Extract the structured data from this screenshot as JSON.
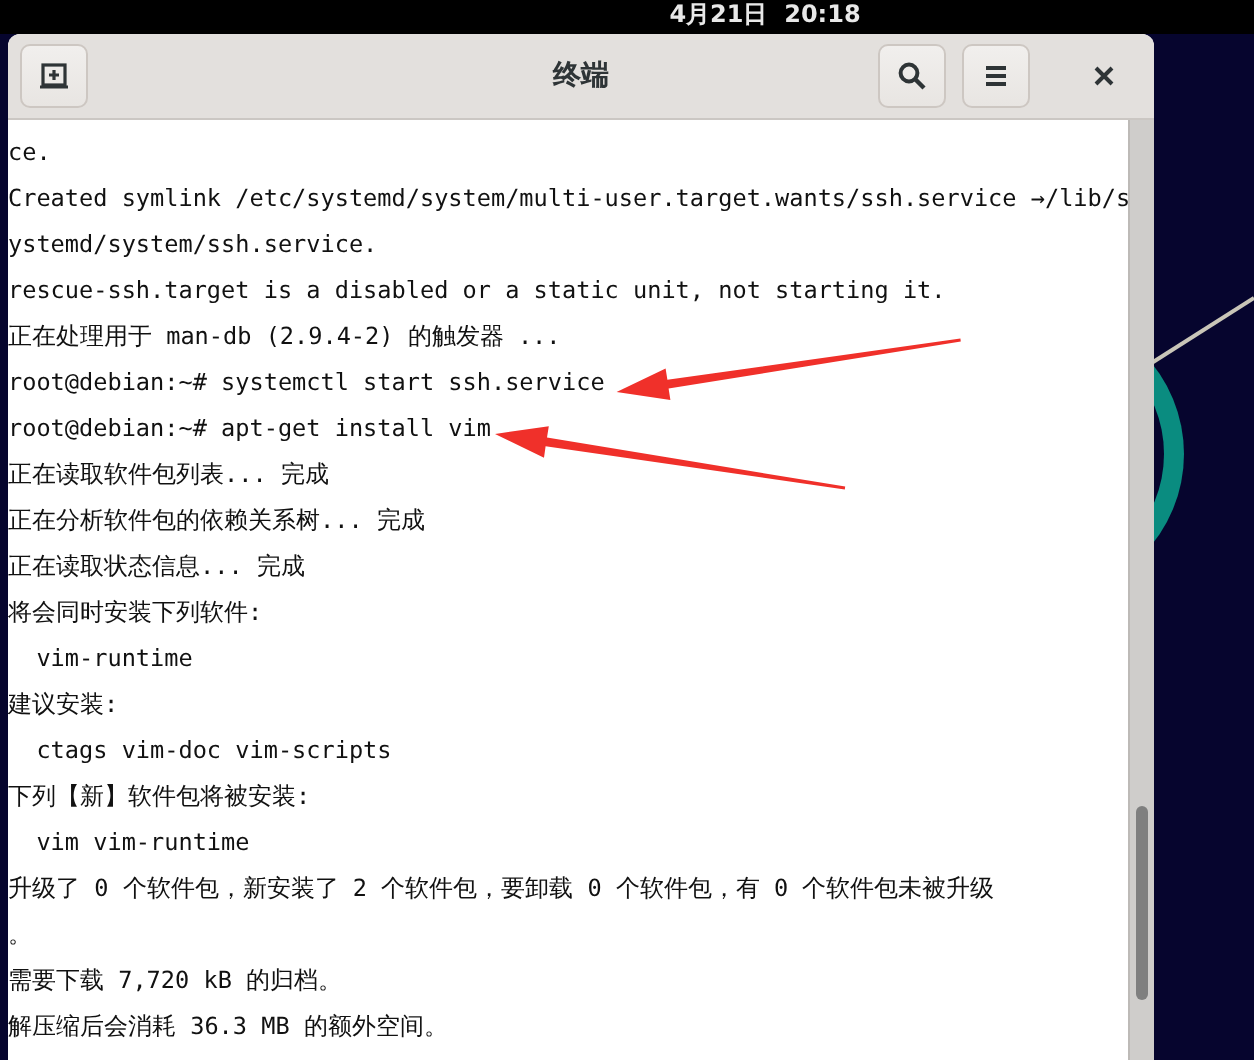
{
  "top_bar": {
    "clock": "4月21日  20:18"
  },
  "window": {
    "title": "终端",
    "header_buttons": [
      {
        "kind": "new-tab"
      },
      {
        "kind": "search"
      },
      {
        "kind": "menu"
      },
      {
        "kind": "close"
      }
    ]
  },
  "terminal": {
    "lines": [
      "ce.",
      "Created symlink /etc/systemd/system/multi-user.target.wants/ssh.service →/lib/s",
      "ystemd/system/ssh.service.",
      "rescue-ssh.target is a disabled or a static unit, not starting it.",
      "正在处理用于 man-db (2.9.4-2) 的触发器 ...",
      "root@debian:~# systemctl start ssh.service",
      "root@debian:~# apt-get install vim",
      "正在读取软件包列表... 完成",
      "正在分析软件包的依赖关系树... 完成",
      "正在读取状态信息... 完成",
      "将会同时安装下列软件:",
      "  vim-runtime",
      "建议安装:",
      "  ctags vim-doc vim-scripts",
      "下列【新】软件包将被安装:",
      "  vim vim-runtime",
      "升级了 0 个软件包，新安装了 2 个软件包，要卸载 0 个软件包，有 0 个软件包未被升级",
      "。",
      "需要下载 7,720 kB 的归档。",
      "解压缩后会消耗 36.3 MB 的额外空间。"
    ]
  },
  "annotations": [
    {
      "kind": "arrow"
    },
    {
      "kind": "arrow"
    }
  ]
}
